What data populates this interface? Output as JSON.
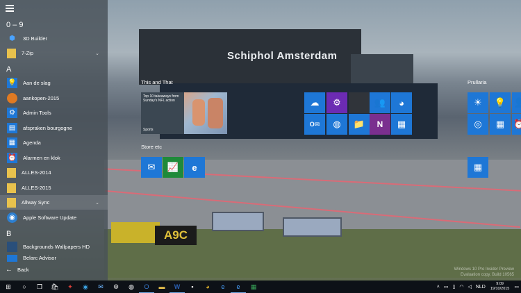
{
  "background": {
    "sign_text": "Schiphol Amsterdam",
    "stand_marker": "A9C",
    "watermark_lines": [
      "Windows 10 Pro Insider Preview",
      "Evaluation copy. Build 10565"
    ]
  },
  "app_list": {
    "groups": [
      {
        "letter": "0 – 9",
        "items": [
          {
            "label": "3D Builder",
            "icon": "3d-builder-icon"
          },
          {
            "label": "7-Zip",
            "icon": "folder-icon",
            "expandable": true
          }
        ]
      },
      {
        "letter": "A",
        "items": [
          {
            "label": "Aan de slag",
            "icon": "lightbulb-icon"
          },
          {
            "label": "aankopen-2015",
            "icon": "pumpkin-icon"
          },
          {
            "label": "Admin Tools",
            "icon": "admin-tools-icon"
          },
          {
            "label": "afspraken bourgogne",
            "icon": "document-icon"
          },
          {
            "label": "Agenda",
            "icon": "calendar-icon"
          },
          {
            "label": "Alarmen en klok",
            "icon": "alarm-clock-icon"
          },
          {
            "label": "ALLES-2014",
            "icon": "folder-icon"
          },
          {
            "label": "ALLES-2015",
            "icon": "folder-icon"
          },
          {
            "label": "Allway Sync",
            "icon": "folder-icon",
            "expandable": true
          },
          {
            "label": "Apple Software Update",
            "icon": "apple-update-icon"
          }
        ]
      },
      {
        "letter": "B",
        "items": [
          {
            "label": "Backgrounds Wallpapers HD",
            "icon": "wallpaper-icon"
          },
          {
            "label": "Belarc Advisor",
            "icon": "belarc-icon"
          }
        ]
      }
    ],
    "back_label": "Back"
  },
  "tile_groups": {
    "this_and_that": {
      "title": "This and That",
      "news_text": "Top 10 takeaways from Sunday's NFL action",
      "news_tag": "Sports"
    },
    "store_etc": {
      "title": "Store etc"
    },
    "prullaria": {
      "title": "Prullaria"
    }
  },
  "taskbar": {
    "language": "NLD",
    "time": "9:09",
    "date": "19/10/2015"
  },
  "colors": {
    "tile_blue": "#1e77d6",
    "tile_purple": "#6c2bb3",
    "onenote_purple": "#7a2f8f",
    "excel_green": "#1f8a3a",
    "taskbar": "#0d1117"
  }
}
